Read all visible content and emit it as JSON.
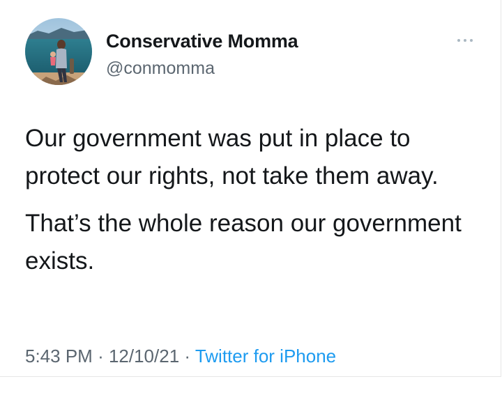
{
  "author": {
    "display_name": "Conservative Momma",
    "handle": "@conmomma"
  },
  "tweet": {
    "paragraphs": [
      "Our government was put in place to protect our rights, not take them away.",
      "That’s the whole reason our government exists."
    ]
  },
  "meta": {
    "time": "5:43 PM",
    "separator": "·",
    "date": "12/10/21",
    "source": "Twitter for iPhone"
  },
  "icons": {
    "more": "more-options-icon",
    "avatar": "profile-photo"
  },
  "colors": {
    "text": "#14171a",
    "secondary": "#5b6670",
    "link": "#1d9bf0"
  }
}
